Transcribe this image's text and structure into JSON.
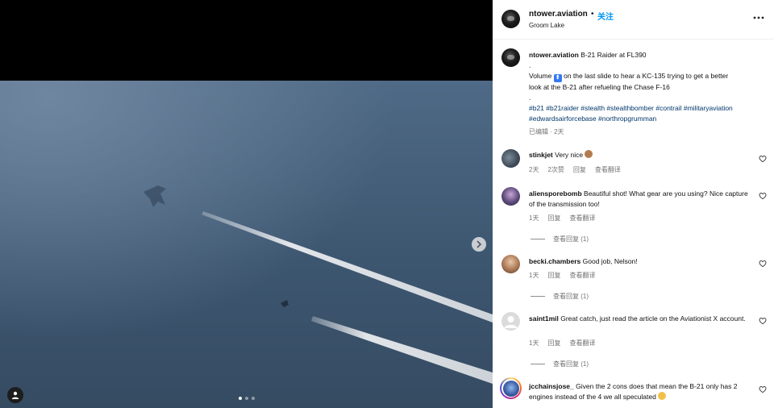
{
  "post": {
    "author": "ntower.aviation",
    "separator": "•",
    "follow_label": "关注",
    "location": "Groom Lake",
    "more_icon": "more-horizontal-icon"
  },
  "media": {
    "slide_count": 3,
    "active_slide": 1,
    "next_icon": "chevron-right-icon",
    "user_tag_icon": "user-tag-icon"
  },
  "caption": {
    "author": "ntower.aviation",
    "title": "B-21 Raider at FL390",
    "dot1": ".",
    "body_volume": "Volume",
    "emoji_badge": "⬆",
    "body_rest": "on the last slide to hear a KC-135 trying to get a better look at the B-21 after refueling the Chase F-16",
    "dot2": ".",
    "hashtags": "#b21 #b21raider #stealth #stealthbomber #contrail #militaryaviation #edwardsairforcebase #northropgrumman",
    "edited": "已编辑 · 2天"
  },
  "comments": [
    {
      "username": "stinkjet",
      "text": "Very nice",
      "emoji": "clapping-hands",
      "time": "2天",
      "likes": "2次赞",
      "reply": "回复",
      "translate": "查看翻译"
    },
    {
      "username": "aliensporebomb",
      "text": "Beautiful shot! What gear are you using? Nice capture of the transmission too!",
      "time": "1天",
      "reply": "回复",
      "translate": "查看翻译",
      "view_replies": "查看回复 (1)"
    },
    {
      "username": "becki.chambers",
      "text": "Good job, Nelson!",
      "time": "1天",
      "reply": "回复",
      "translate": "查看翻译",
      "view_replies": "查看回复 (1)"
    },
    {
      "username": "saint1mil",
      "text": "Great catch, just read the article on the Aviationist X account.",
      "time": "1天",
      "reply": "回复",
      "translate": "查看翻译",
      "view_replies": "查看回复 (1)"
    },
    {
      "username": "jcchainsjose_",
      "text": "Given the 2 cons does that mean the B-21 only has 2 engines instead of the 4 we all speculated",
      "emoji": "thinking-face"
    }
  ],
  "colors": {
    "follow_blue": "#0095f6",
    "hashtag_blue": "#00376b",
    "meta_gray": "#737373"
  }
}
